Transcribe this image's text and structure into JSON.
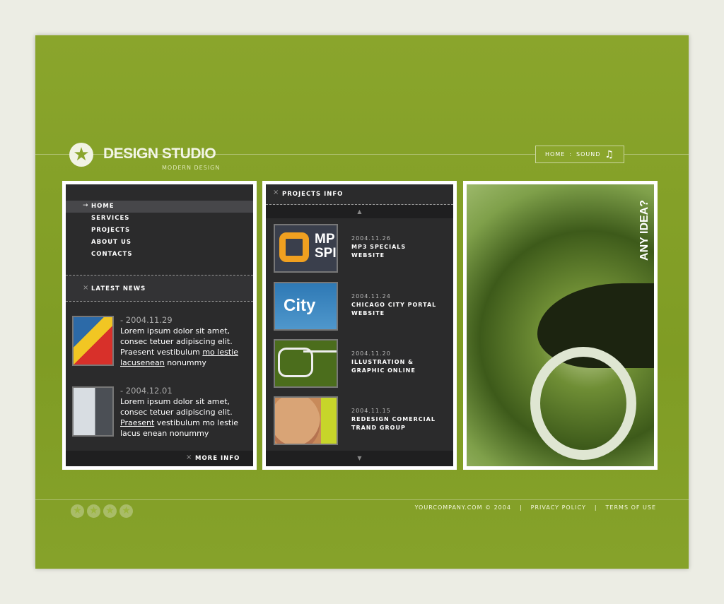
{
  "brand": {
    "title": "DESIGN STUDIO",
    "subtitle": "MODERN DESIGN"
  },
  "topnav": {
    "home": "HOME",
    "separator": ":",
    "sound": "SOUND"
  },
  "menu": {
    "items": [
      {
        "label": "HOME",
        "active": true
      },
      {
        "label": "SERVICES"
      },
      {
        "label": "PROJECTS"
      },
      {
        "label": "ABOUT US"
      },
      {
        "label": "CONTACTS"
      }
    ]
  },
  "news": {
    "heading": "LATEST NEWS",
    "more": "MORE INFO",
    "items": [
      {
        "date": "- 2004.11.29",
        "l1": "Lorem ipsum dolor sit amet,",
        "l2": "consec tetuer adipiscing elit.",
        "l3a": "Praesent vestibulum ",
        "l3b": "mo lestie",
        "l4a": "lacusenean",
        "l4b": " nonummy"
      },
      {
        "date": "- 2004.12.01",
        "l1": "Lorem ipsum dolor sit amet,",
        "l2": "consec tetuer adipiscing elit.",
        "l3a": "Praesent",
        "l3b": " vestibulum mo lestie",
        "l4a": "",
        "l4b": "lacus enean nonummy"
      }
    ]
  },
  "projects": {
    "heading": "PROJECTS INFO",
    "items": [
      {
        "date": "2004.11.26",
        "title1": "MP3 SPECIALS",
        "title2": "WEBSITE",
        "thumb_text": "MP SPI"
      },
      {
        "date": "2004.11.24",
        "title1": "CHICAGO CITY PORTAL",
        "title2": "WEBSITE",
        "thumb_text": "City"
      },
      {
        "date": "2004.11.20",
        "title1": "ILLUSTRATION &",
        "title2": "GRAPHIC ONLINE"
      },
      {
        "date": "2004.11.15",
        "title1": "REDESIGN COMERCIAL",
        "title2": "TRAND GROUP"
      }
    ]
  },
  "promo": {
    "text": "ANY IDEA?"
  },
  "footer": {
    "copyright": "YOURCOMPANY.COM © 2004",
    "sep": "|",
    "privacy": "PRIVACY POLICY",
    "terms": "TERMS OF USE"
  },
  "colors": {
    "green": "#8aa52c",
    "panel": "#2b2b2c"
  }
}
